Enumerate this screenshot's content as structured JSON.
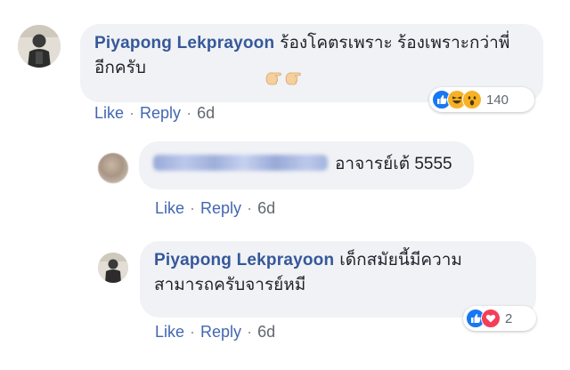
{
  "comment1": {
    "author": "Piyapong Lekprayoon",
    "text": "ร้องโคตรเพราะ ร้องเพราะกว่าพี่อีกครับ",
    "actions": {
      "like": "Like",
      "reply": "Reply",
      "time": "6d"
    },
    "reactions": {
      "types": [
        "like-icon",
        "haha-icon",
        "wow-icon"
      ],
      "count": "140"
    }
  },
  "reply1": {
    "author_obscured": true,
    "text": "อาจารย์เต้ 5555",
    "actions": {
      "like": "Like",
      "reply": "Reply",
      "time": "6d"
    }
  },
  "reply2": {
    "author": "Piyapong Lekprayoon",
    "text": "เด็กสมัยนี้มีความสามารถครับจารย์หมี",
    "actions": {
      "like": "Like",
      "reply": "Reply",
      "time": "6d"
    },
    "reactions": {
      "types": [
        "like-icon",
        "love-icon"
      ],
      "count": "2"
    }
  },
  "colors": {
    "name": "#365899",
    "link": "#4267b2",
    "bubble": "#f0f2f5",
    "like": "#1877f2",
    "love": "#f33e58",
    "haha": "#f7b125"
  }
}
